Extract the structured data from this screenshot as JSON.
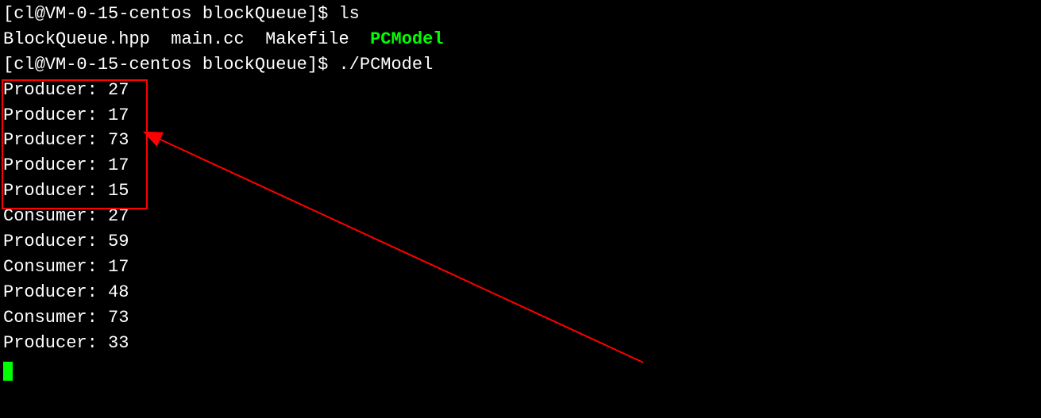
{
  "prompt1": "[cl@VM-0-15-centos blockQueue]$ ",
  "cmd1": "ls",
  "ls_out": {
    "f1": "BlockQueue.hpp",
    "f2": "main.cc",
    "f3": "Makefile",
    "f4": "PCModel"
  },
  "prompt2": "[cl@VM-0-15-centos blockQueue]$ ",
  "cmd2": "./PCModel",
  "output": {
    "l1": "Producer: 27",
    "l2": "Producer: 17",
    "l3": "Producer: 73",
    "l4": "Producer: 17",
    "l5": "Producer: 15",
    "l6": "Consumer: 27",
    "l7": "Producer: 59",
    "l8": "Consumer: 17",
    "l9": "Producer: 48",
    "l10": "Consumer: 73",
    "l11": "Producer: 33"
  }
}
